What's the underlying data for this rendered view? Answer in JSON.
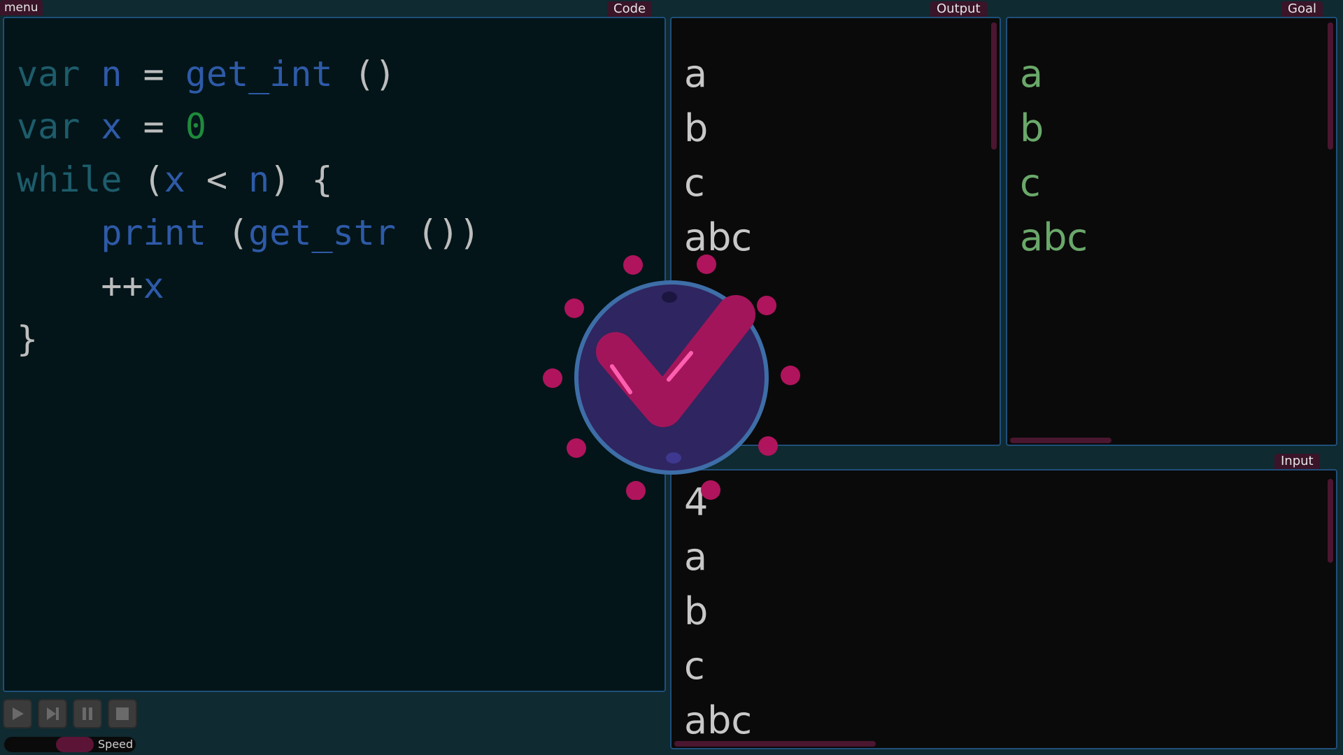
{
  "menu": {
    "label": "menu"
  },
  "panels": {
    "code_title": "Code",
    "output_title": "Output",
    "goal_title": "Goal",
    "input_title": "Input"
  },
  "code": {
    "line1": {
      "kw": "var",
      "name": "n",
      "eq": "=",
      "fn": "get_int",
      "args": "()"
    },
    "line2": {
      "kw": "var",
      "name": "x",
      "eq": "=",
      "value": "0"
    },
    "line3": {
      "kw": "while",
      "open": "(",
      "left": "x",
      "op": "<",
      "right": "n",
      "close": ") {"
    },
    "line4": {
      "fn": "print",
      "open": "(",
      "inner_fn": "get_str",
      "inner_args": "()",
      "close": ")"
    },
    "line5": {
      "op": "++",
      "name": "x"
    },
    "line6": {
      "brace": "}"
    }
  },
  "output": {
    "lines": [
      "a",
      "b",
      "c",
      "abc"
    ]
  },
  "goal": {
    "lines": [
      "a",
      "b",
      "c",
      "abc"
    ]
  },
  "input": {
    "lines": [
      "4",
      "a",
      "b",
      "c",
      "abc"
    ]
  },
  "controls": {
    "speed_label": "Speed",
    "speed_level": 0.6,
    "play_icon": "play-icon",
    "step_icon": "step-forward-icon",
    "pause_icon": "pause-icon",
    "stop_icon": "stop-icon"
  },
  "badge": {
    "icon": "checkmark-icon",
    "state": "success"
  },
  "colors": {
    "background": "#0f2a30",
    "panel_border": "#1f4f7a",
    "accent": "#a3155a",
    "keyword": "#1d5c6b",
    "identifier": "#2e5aa8",
    "number": "#1f8a3c",
    "goal_text": "#6aa86a"
  }
}
